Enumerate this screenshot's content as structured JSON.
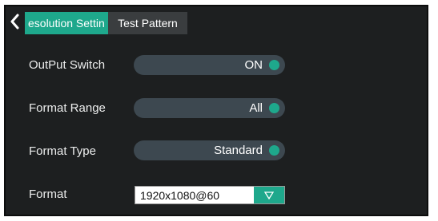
{
  "tabs": [
    {
      "label": "esolution Settin",
      "active": true
    },
    {
      "label": "Test Pattern",
      "active": false
    }
  ],
  "rows": [
    {
      "label": "OutPut Switch",
      "value": "ON"
    },
    {
      "label": "Format Range",
      "value": "All"
    },
    {
      "label": "Format Type",
      "value": "Standard"
    }
  ],
  "format": {
    "label": "Format",
    "selected": "1920x1080@60"
  },
  "colors": {
    "accent": "#1ea88c",
    "panel": "#1d1f20",
    "pill": "#3d4850",
    "tab_inactive": "#3a3d3f"
  },
  "icons": [
    "chevron-left-icon",
    "toggle-dot-icon",
    "dropdown-triangle-icon"
  ]
}
